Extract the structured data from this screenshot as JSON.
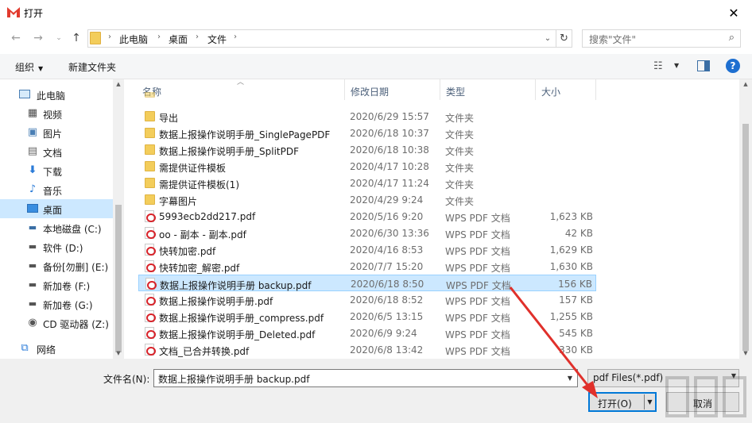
{
  "window": {
    "title": "打开"
  },
  "nav": {
    "breadcrumbs": [
      "此电脑",
      "桌面",
      "文件"
    ],
    "search_placeholder": "搜索\"文件\""
  },
  "toolbar": {
    "organize": "组织",
    "new_folder": "新建文件夹"
  },
  "sidebar": {
    "items": [
      {
        "label": "此电脑",
        "icon": "computer-icon"
      },
      {
        "label": "视频",
        "icon": "video-icon"
      },
      {
        "label": "图片",
        "icon": "picture-icon"
      },
      {
        "label": "文档",
        "icon": "document-icon"
      },
      {
        "label": "下载",
        "icon": "download-icon"
      },
      {
        "label": "音乐",
        "icon": "music-icon"
      },
      {
        "label": "桌面",
        "icon": "desktop-icon",
        "selected": true
      },
      {
        "label": "本地磁盘 (C:)",
        "icon": "drive-icon"
      },
      {
        "label": "软件 (D:)",
        "icon": "drive-icon"
      },
      {
        "label": "备份[勿删] (E:)",
        "icon": "drive-icon"
      },
      {
        "label": "新加卷 (F:)",
        "icon": "drive-icon"
      },
      {
        "label": "新加卷 (G:)",
        "icon": "drive-icon"
      },
      {
        "label": "CD 驱动器 (Z:)",
        "icon": "cd-drive-icon"
      },
      {
        "label": "网络",
        "icon": "network-icon"
      }
    ]
  },
  "columns": {
    "name": "名称",
    "date": "修改日期",
    "type": "类型",
    "size": "大小"
  },
  "files": [
    {
      "name": "导出",
      "date": "2020/6/29 15:57",
      "type": "文件夹",
      "size": "",
      "kind": "folder"
    },
    {
      "name": "数据上报操作说明手册_SinglePagePDF",
      "date": "2020/6/18 10:37",
      "type": "文件夹",
      "size": "",
      "kind": "folder"
    },
    {
      "name": "数据上报操作说明手册_SplitPDF",
      "date": "2020/6/18 10:38",
      "type": "文件夹",
      "size": "",
      "kind": "folder"
    },
    {
      "name": "需提供证件模板",
      "date": "2020/4/17 10:28",
      "type": "文件夹",
      "size": "",
      "kind": "folder"
    },
    {
      "name": "需提供证件模板(1)",
      "date": "2020/4/17 11:24",
      "type": "文件夹",
      "size": "",
      "kind": "folder"
    },
    {
      "name": "字幕图片",
      "date": "2020/4/29 9:24",
      "type": "文件夹",
      "size": "",
      "kind": "folder"
    },
    {
      "name": "5993ecb2dd217.pdf",
      "date": "2020/5/16 9:20",
      "type": "WPS PDF 文档",
      "size": "1,623 KB",
      "kind": "pdf"
    },
    {
      "name": "oo - 副本 - 副本.pdf",
      "date": "2020/6/30 13:36",
      "type": "WPS PDF 文档",
      "size": "42 KB",
      "kind": "pdf"
    },
    {
      "name": "快转加密.pdf",
      "date": "2020/4/16 8:53",
      "type": "WPS PDF 文档",
      "size": "1,629 KB",
      "kind": "pdf"
    },
    {
      "name": "快转加密_解密.pdf",
      "date": "2020/7/7 15:20",
      "type": "WPS PDF 文档",
      "size": "1,630 KB",
      "kind": "pdf"
    },
    {
      "name": "数据上报操作说明手册 backup.pdf",
      "date": "2020/6/18 8:50",
      "type": "WPS PDF 文档",
      "size": "156 KB",
      "kind": "pdf",
      "selected": true
    },
    {
      "name": "数据上报操作说明手册.pdf",
      "date": "2020/6/18 8:52",
      "type": "WPS PDF 文档",
      "size": "157 KB",
      "kind": "pdf"
    },
    {
      "name": "数据上报操作说明手册_compress.pdf",
      "date": "2020/6/5 13:15",
      "type": "WPS PDF 文档",
      "size": "1,255 KB",
      "kind": "pdf"
    },
    {
      "name": "数据上报操作说明手册_Deleted.pdf",
      "date": "2020/6/9 9:24",
      "type": "WPS PDF 文档",
      "size": "545 KB",
      "kind": "pdf"
    },
    {
      "name": "文档_已合并转换.pdf",
      "date": "2020/6/8 13:42",
      "type": "WPS PDF 文档",
      "size": "330 KB",
      "kind": "pdf"
    }
  ],
  "bottom": {
    "filename_label": "文件名(N):",
    "filename_value": "数据上报操作说明手册 backup.pdf",
    "filetype_value": "pdf Files(*.pdf)",
    "open_label": "打开(O)",
    "cancel_label": "取消"
  },
  "colors": {
    "selection": "#cce8ff",
    "accent": "#0078d7",
    "arrow": "#e0302b"
  }
}
